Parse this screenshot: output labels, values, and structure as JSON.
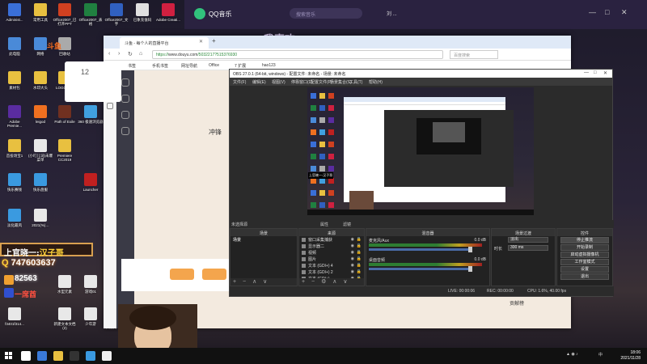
{
  "desktop": {
    "icons": [
      {
        "label": "Administ...",
        "color": "#3a6fd8"
      },
      {
        "label": "常用工具",
        "color": "#e8c040"
      },
      {
        "label": "Office2007_已打开PPT",
        "color": "#d04020"
      },
      {
        "label": "Office2007_表格",
        "color": "#208040"
      },
      {
        "label": "Office2007_文字",
        "color": "#3060c0"
      },
      {
        "label": "已象充值码",
        "color": "#e0e0e0"
      },
      {
        "label": "Adobe Creati...",
        "color": "#d02040"
      },
      {
        "label": "此电脑",
        "color": "#4a8ad8"
      },
      {
        "label": "网络",
        "color": "#4a8ad8"
      },
      {
        "label": "回收站",
        "color": "#aaaaaa"
      },
      {
        "label": "素材包",
        "color": "#e8c040"
      },
      {
        "label": "水印大头",
        "color": "#e8c040"
      },
      {
        "label": "LOGO素材",
        "color": "#e8c040"
      },
      {
        "label": "素材有偿化",
        "color": "#e8c040"
      },
      {
        "label": "Adobe Premie...",
        "color": "#5a2ca0"
      },
      {
        "label": "leigod",
        "color": "#f07020"
      },
      {
        "label": "Path of Exile",
        "color": "#703020"
      },
      {
        "label": "360 极速浏览器",
        "color": "#40a0e0"
      },
      {
        "label": "首投场宝1",
        "color": "#e8c040"
      },
      {
        "label": "(小叮儿词)未爆菜单",
        "color": "#e8e8e8"
      },
      {
        "label": "Premiere CC2019",
        "color": "#e8c040"
      },
      {
        "label": "快乐赛钱",
        "color": "#3a9ae0"
      },
      {
        "label": "快乐盘服",
        "color": "#3a9ae0"
      },
      {
        "label": "Launcher",
        "color": "#c02020"
      },
      {
        "label": "淡化最风",
        "color": "#3a9ae0"
      },
      {
        "label": "2021(%)…",
        "color": "#e8e8e8"
      },
      {
        "label": "水型元素",
        "color": "#e8e8e8"
      },
      {
        "label": "游戏01",
        "color": "#e8e8e8"
      },
      {
        "label": "f3401f314...",
        "color": "#e8e8e8"
      },
      {
        "label": "新建文本文档 (2)",
        "color": "#e8e8e8"
      },
      {
        "label": "少年游",
        "color": "#e8e8e8"
      },
      {
        "label": "新建文本文档",
        "color": "#e8e8e8"
      }
    ]
  },
  "qq_music": {
    "title": "QQ音乐",
    "search_placeholder": "搜索音乐",
    "user": "刘 ...",
    "heading": "我喜欢",
    "minimize": "—",
    "maximize": "□",
    "close": "✕"
  },
  "browser": {
    "tab_title": "斗鱼 - 每个人的直播平台",
    "url_prefix": "https://",
    "url_domain": "www.douyu.com",
    "url_path": "/5032217?515376930",
    "search_placeholder": "百度搜索",
    "bookmarks": [
      "书签",
      "手机书签",
      "网址导航",
      "Office",
      "7 扩展",
      "hao123"
    ],
    "side_num": "12",
    "side_text": "冲锋",
    "rank_label": "贡献榜"
  },
  "obs": {
    "title": "OBS 27.0.1 (64-bit, windows) - 配置文件: 未命名 - 场景: 未命名",
    "menu": [
      "文件(F)",
      "编辑(E)",
      "视图(V)",
      "停靠窗口(D)",
      "配置文件(P)",
      "场景集合(S)",
      "工具(T)",
      "帮助(H)"
    ],
    "no_source": "未选择源",
    "prop_label": "属性",
    "filter_label": "滤镜",
    "scenes_header": "场景",
    "scenes": [
      "场景"
    ],
    "sources_header": "来源",
    "sources": [
      {
        "name": "窗口采集捕获",
        "type": "window"
      },
      {
        "name": "显示器二",
        "type": "display"
      },
      {
        "name": "视频",
        "type": "video"
      },
      {
        "name": "图片",
        "type": "image"
      },
      {
        "name": "文本 (GDI+) 4",
        "type": "text"
      },
      {
        "name": "文本 (GDI+) 2",
        "type": "text"
      },
      {
        "name": "文本 (GDI+)",
        "type": "text"
      }
    ],
    "mixer_header": "混音器",
    "mixer": [
      {
        "name": "麦克风/Aux",
        "db": "0.0 dB"
      },
      {
        "name": "桌面音频",
        "db": "0.0 dB"
      }
    ],
    "transitions_header": "场景过渡",
    "transition_name": "淡出",
    "duration_label": "时长",
    "duration": "300 ms",
    "controls_header": "控件",
    "controls": [
      "停止推流",
      "开始录制",
      "启动虚拟摄像机",
      "工作室模式",
      "设置",
      "退出"
    ],
    "status": {
      "live": "LIVE: 00:00:06",
      "rec": "REC: 00:00:00",
      "cpu": "CPU: 1.6%, 40.00 fps"
    }
  },
  "overlay": {
    "title_prefix": "上官晓一:",
    "title_name": "汉子哥",
    "qq_prefix": "Q",
    "qq_number": "747603637",
    "fans_id": "82563",
    "fans_label": "一席酋"
  },
  "taskbar": {
    "time": "18:06",
    "date": "2021/11/28",
    "lang": "中",
    "apps": [
      {
        "color": "#ffffff"
      },
      {
        "color": "#3a7ad8"
      },
      {
        "color": "#e8c040"
      },
      {
        "color": "#333333"
      },
      {
        "color": "#3a9ae0"
      },
      {
        "color": "#f0f0f0"
      }
    ]
  }
}
